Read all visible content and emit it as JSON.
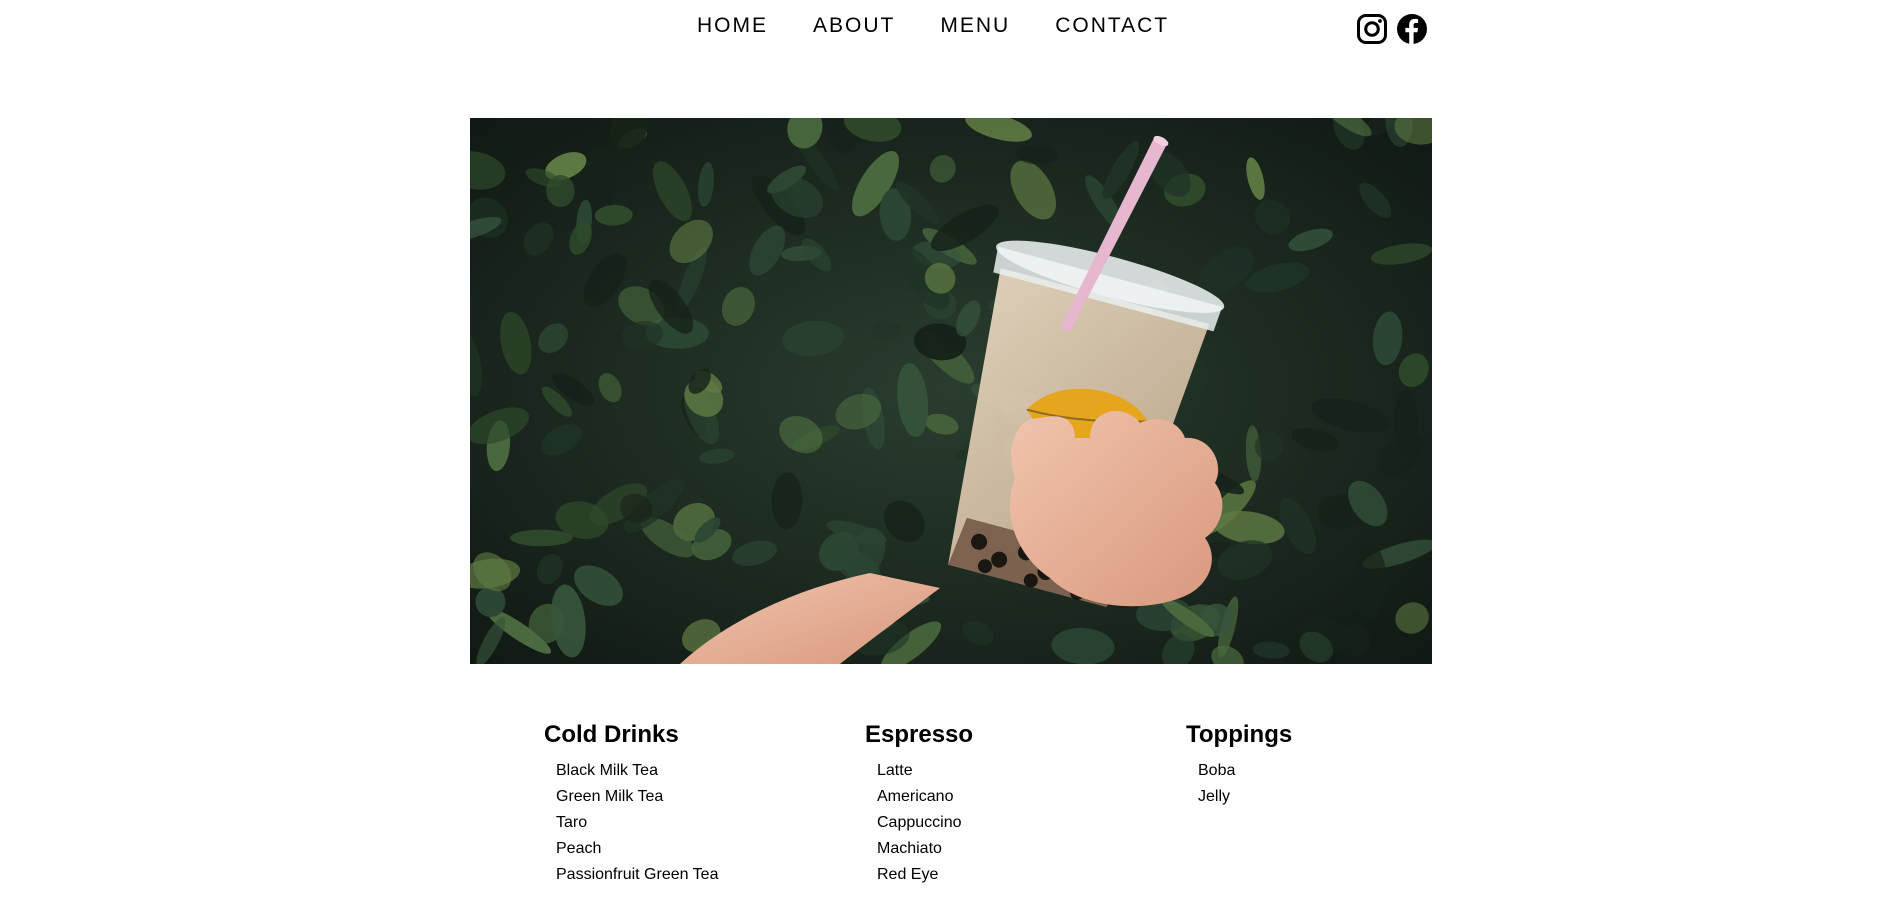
{
  "nav": {
    "links": [
      {
        "label": "HOME"
      },
      {
        "label": "ABOUT"
      },
      {
        "label": "MENU"
      },
      {
        "label": "CONTACT"
      }
    ],
    "social": [
      {
        "icon": "instagram-icon"
      },
      {
        "icon": "facebook-icon"
      }
    ]
  },
  "hero": {
    "image": "bubble-tea-photo"
  },
  "menu": {
    "sections": [
      {
        "title": "Cold Drinks",
        "items": [
          "Black Milk Tea",
          "Green Milk Tea",
          "Taro",
          "Peach",
          "Passionfruit Green Tea"
        ]
      },
      {
        "title": "Espresso",
        "items": [
          "Latte",
          "Americano",
          "Cappuccino",
          "Machiato",
          "Red Eye"
        ]
      },
      {
        "title": "Toppings",
        "items": [
          "Boba",
          "Jelly"
        ]
      }
    ]
  },
  "colors": {
    "text": "#000000",
    "background": "#ffffff",
    "leaf_dark": "#1b2820",
    "tea": "#d9c6ad",
    "straw": "#e7b7cf",
    "logo": "#e5a51c"
  }
}
